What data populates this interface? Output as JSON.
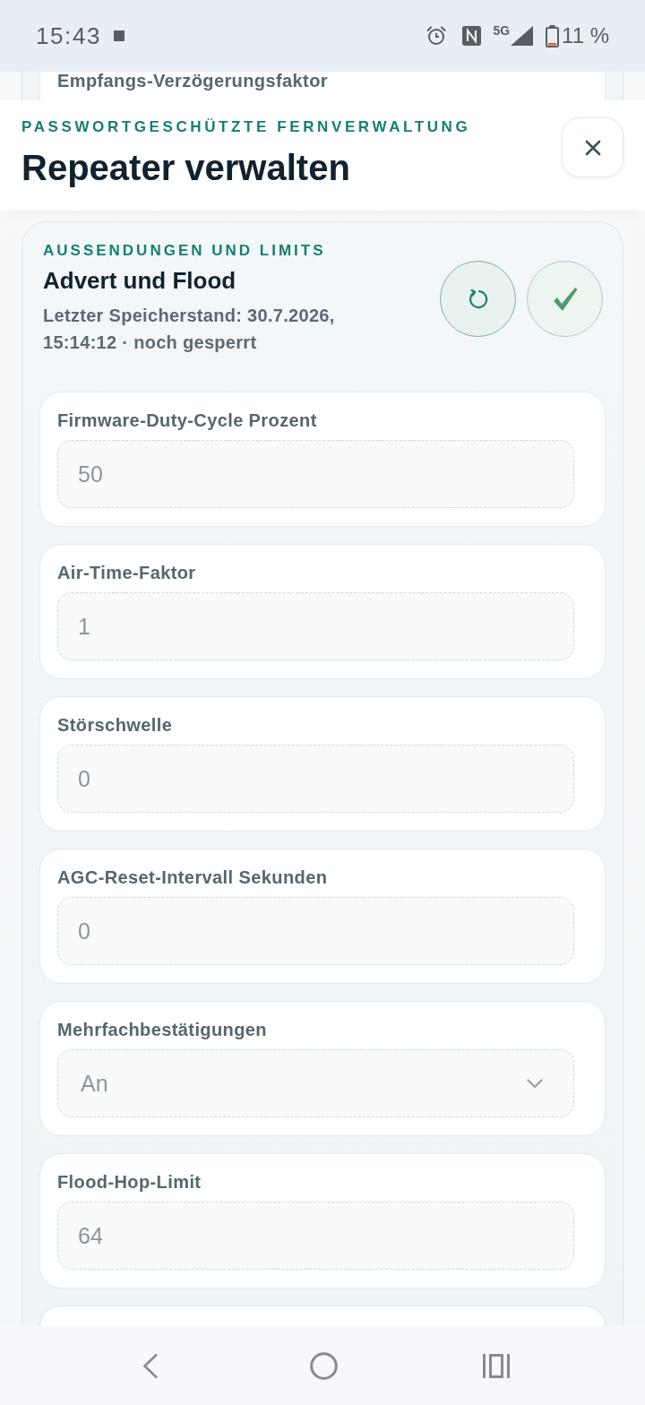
{
  "status_bar": {
    "time": "15:43",
    "network": "5G",
    "battery": "11 %"
  },
  "previous_field": {
    "label": "Empfangs-Verzögerungsfaktor"
  },
  "header": {
    "kicker": "PASSWORTGESCHÜTZTE FERNVERWALTUNG",
    "title": "Repeater verwalten"
  },
  "section": {
    "kicker": "AUSSENDUNGEN UND LIMITS",
    "title": "Advert und Flood",
    "subtitle": "Letzter Speicherstand: 30.7.2026, 15:14:12 · noch gesperrt",
    "fields": [
      {
        "kind": "input",
        "label": "Firmware-Duty-Cycle Prozent",
        "value": "50",
        "disabled": true
      },
      {
        "kind": "input",
        "label": "Air-Time-Faktor",
        "value": "1",
        "disabled": true
      },
      {
        "kind": "input",
        "label": "Störschwelle",
        "value": "0",
        "disabled": true
      },
      {
        "kind": "input",
        "label": "AGC-Reset-Intervall Sekunden",
        "value": "0",
        "disabled": true
      },
      {
        "kind": "select",
        "label": "Mehrfachbestätigungen",
        "value": "An",
        "disabled": true
      },
      {
        "kind": "input",
        "label": "Flood-Hop-Limit",
        "value": "64",
        "disabled": true
      }
    ]
  }
}
